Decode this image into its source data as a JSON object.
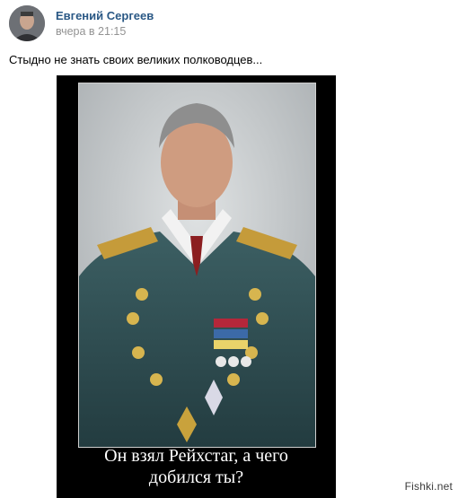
{
  "post": {
    "author_name": "Евгений Сергеев",
    "timestamp": "вчера в 21:15",
    "text": "Стыдно не знать своих великих полководцев...",
    "image": {
      "caption_line1": "Он взял Рейхстаг, а чего",
      "caption_line2": "добился ты?"
    }
  },
  "watermark": "Fishki.net",
  "colors": {
    "author_link": "#2a5885",
    "timestamp": "#939393",
    "poster_frame": "#000000"
  }
}
